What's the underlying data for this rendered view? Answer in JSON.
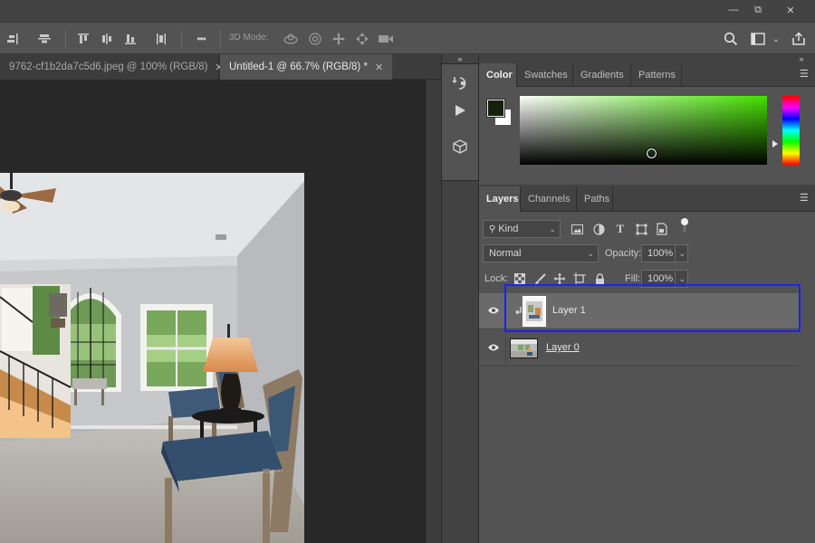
{
  "window": {
    "minimize_glyph": "—",
    "restore_glyph": "⧉",
    "close_glyph": "✕"
  },
  "options_bar": {
    "mode_label": "3D Mode:",
    "more_glyph": "•••"
  },
  "document_tabs": [
    {
      "label": "9762-cf1b2da7c5d6.jpeg @ 100% (RGB/8)",
      "close": "✕",
      "active": false
    },
    {
      "label": "Untitled-1 @ 66.7% (RGB/8) *",
      "close": "✕",
      "active": true
    }
  ],
  "dock": {
    "collapse_glyph": "«",
    "panels_collapse_glyph": "»"
  },
  "color_panel": {
    "tabs": [
      "Color",
      "Swatches",
      "Gradients",
      "Patterns"
    ],
    "foreground_color": "#15200f",
    "background_color": "#ffffff",
    "hue_color": "#44e000"
  },
  "layers_panel": {
    "tabs": [
      "Layers",
      "Channels",
      "Paths"
    ],
    "filter_kind": "Kind",
    "blend_mode": "Normal",
    "opacity_label": "Opacity:",
    "opacity_value": "100%",
    "lock_label": "Lock:",
    "fill_label": "Fill:",
    "fill_value": "100%",
    "layers": [
      {
        "name": "Layer 1",
        "selected": true,
        "clipped": true
      },
      {
        "name": "Layer 0",
        "selected": false,
        "clipped": false
      }
    ]
  },
  "colors": {
    "highlight": "#1a22ff"
  }
}
